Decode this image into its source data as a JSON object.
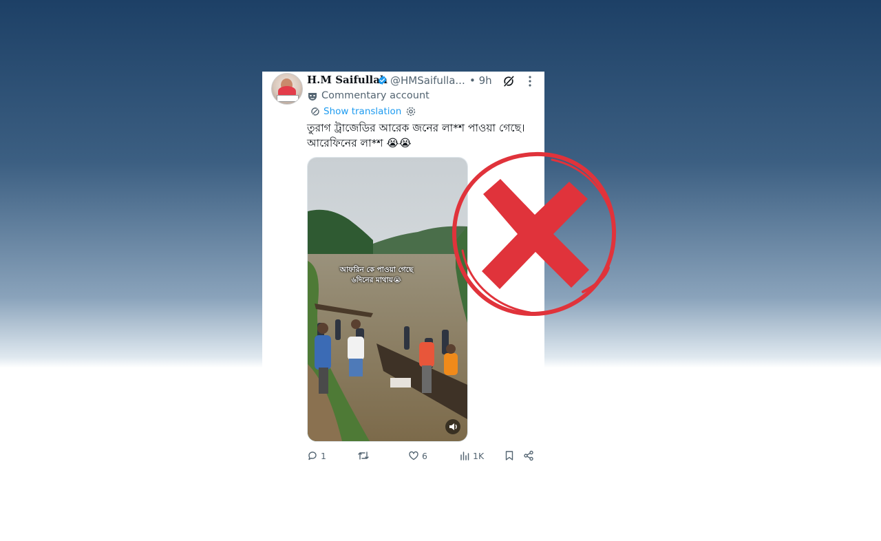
{
  "tweet": {
    "author_name": "H.M Saifullah",
    "handle": "@HMSaifulla...",
    "time": "• 9h",
    "commentary_label": "Commentary account",
    "show_translation": "Show translation",
    "text": "তুরাগ ট্রাজেডির আরেক জনের লা*শ পাওয়া গেছে।\nআরেফিনের লা*শ 😭😭",
    "video_overlay": "আফরিন কে পাওয়া গেছে\n৬দিনের মাথায়😭"
  },
  "actions": {
    "replies": "1",
    "retweets": "",
    "likes": "6",
    "views": "1K"
  },
  "icons": {
    "verified": "verified-badge-icon",
    "grok": "grok-icon",
    "more": "more-options-icon",
    "commentary": "mask-icon",
    "translate": "translate-icon",
    "settings": "gear-icon",
    "mute": "speaker-icon",
    "reply": "reply-icon",
    "retweet": "retweet-icon",
    "like": "heart-icon",
    "views": "views-icon",
    "bookmark": "bookmark-icon",
    "share": "share-icon",
    "overlay": "red-x-icon"
  },
  "colors": {
    "accent": "#1d9bf0",
    "x_mark": "#e0333b",
    "text_secondary": "#536471"
  }
}
